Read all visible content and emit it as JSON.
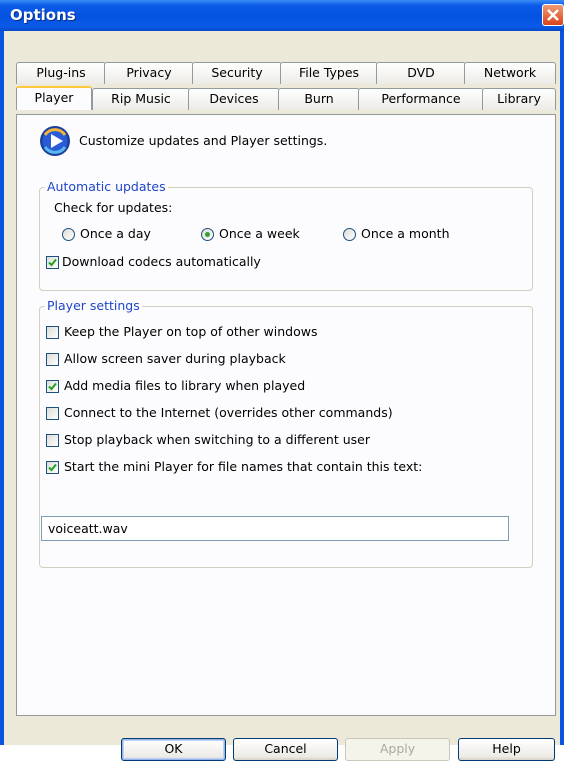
{
  "window": {
    "title": "Options"
  },
  "tabs": {
    "row_back": [
      "Plug-ins",
      "Privacy",
      "Security",
      "File Types",
      "DVD",
      "Network"
    ],
    "row_front": [
      "Player",
      "Rip Music",
      "Devices",
      "Burn",
      "Performance",
      "Library"
    ],
    "active": "Player"
  },
  "intro": {
    "text": "Customize updates and Player settings.",
    "icon": "windows-media-player-icon"
  },
  "auto_updates": {
    "legend": "Automatic updates",
    "check_label": "Check for updates:",
    "options": [
      {
        "label": "Once a day",
        "selected": false
      },
      {
        "label": "Once a week",
        "selected": true
      },
      {
        "label": "Once a month",
        "selected": false
      }
    ],
    "codecs": {
      "label": "Download codecs automatically",
      "checked": true
    }
  },
  "player_settings": {
    "legend": "Player settings",
    "items": [
      {
        "label": "Keep the Player on top of other windows",
        "checked": false
      },
      {
        "label": "Allow screen saver during playback",
        "checked": false
      },
      {
        "label": "Add media files to library when played",
        "checked": true
      },
      {
        "label": "Connect to the Internet (overrides other commands)",
        "checked": false
      },
      {
        "label": "Stop playback when switching to a different user",
        "checked": false
      },
      {
        "label": "Start the mini Player for file names that contain this text:",
        "checked": true
      }
    ],
    "mini_player_text": "voiceatt.wav"
  },
  "buttons": {
    "ok": "OK",
    "cancel": "Cancel",
    "apply": "Apply",
    "help": "Help"
  },
  "colors": {
    "title_bar": "#0a5be8",
    "dialog_bg": "#ece9d8",
    "group_legend": "#1e46c8",
    "active_tab_accent": "#ffc83c"
  }
}
